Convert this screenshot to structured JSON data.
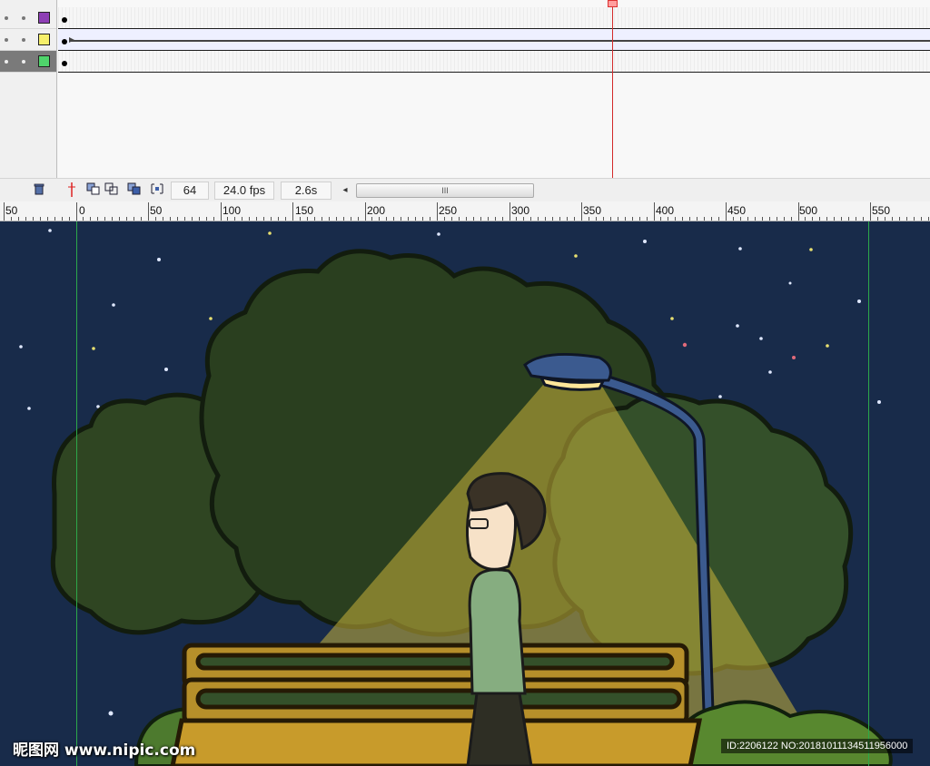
{
  "timeline": {
    "layers": [
      {
        "color": "#8e3fb5"
      },
      {
        "color": "#f7f06a"
      },
      {
        "color": "#4fd46b",
        "selected": true
      }
    ],
    "current_frame": "64",
    "frame_rate": "24.0 fps",
    "elapsed_time": "2.6s",
    "scroll_thumb_label": "III",
    "scroll_left_arrow": "◂",
    "icons": {
      "delete": "trash-icon",
      "center_frame": "center-frame-icon",
      "onion_skin": "onion-skin-icon",
      "onion_outlines": "onion-outlines-icon",
      "edit_multiple": "edit-multiple-frames-icon",
      "onion_markers": "onion-markers-icon"
    }
  },
  "stage_ruler": {
    "labels": [
      "50",
      "0",
      "50",
      "100",
      "150",
      "200",
      "250",
      "300",
      "350",
      "400",
      "450",
      "500",
      "550"
    ]
  },
  "watermark": {
    "logo": "昵图网 www.nipic.com",
    "id_line": "ID:2206122 NO:20181011134511956000"
  },
  "colors": {
    "sky": "#182b4a",
    "tree_dark": "#2a3f20",
    "tree_mid": "#3b5226",
    "lamp_light": "#c8b23a",
    "bench": "#b68f2a",
    "guide_line": "#2ca84a",
    "playhead": "#d32a2a"
  }
}
